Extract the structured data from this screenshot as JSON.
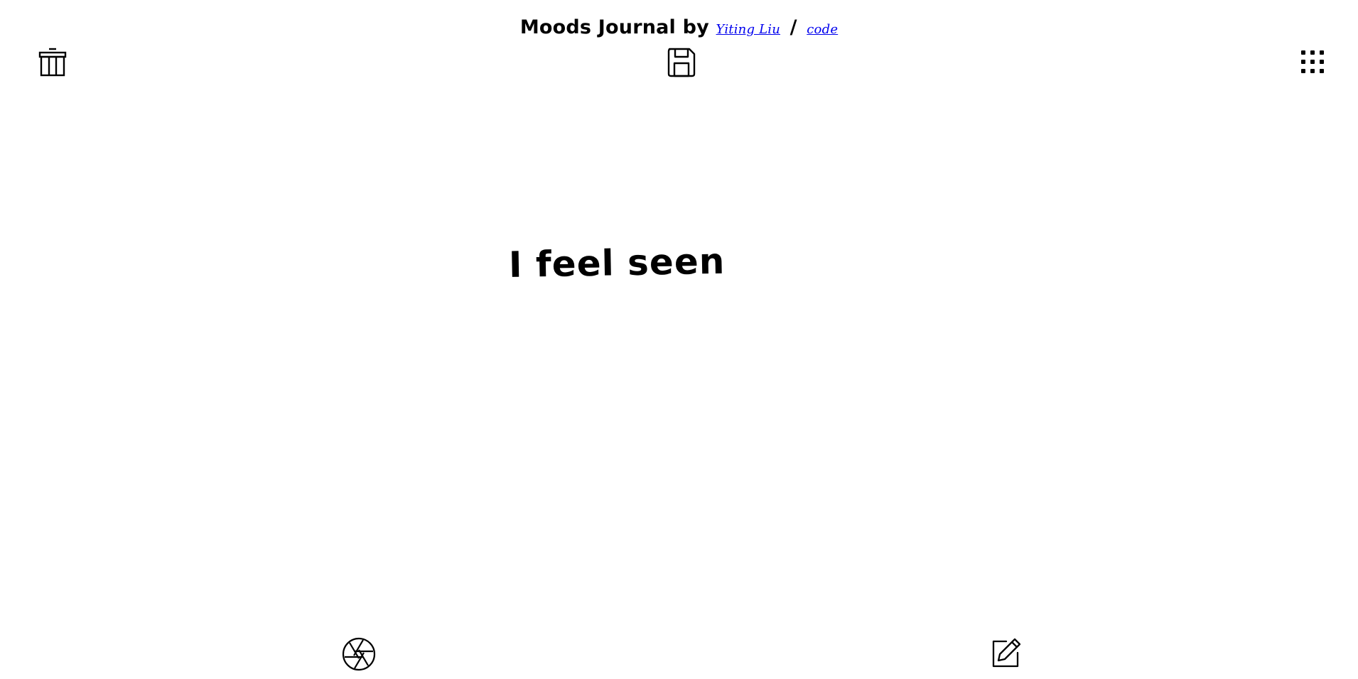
{
  "header": {
    "title_prefix": "Moods Journal by",
    "author_link": "Yiting Liu",
    "separator": "/",
    "code_link": "code"
  },
  "toolbar": {
    "trash_icon": "trash-icon",
    "save_icon": "floppy-disk-icon",
    "grid_icon": "grid-icon"
  },
  "main": {
    "mood_text": "I feel seen"
  },
  "bottom": {
    "camera_icon": "camera-aperture-icon",
    "edit_icon": "edit-pencil-icon"
  },
  "colors": {
    "link": "#0000ee",
    "text": "#000000",
    "background": "#ffffff"
  }
}
